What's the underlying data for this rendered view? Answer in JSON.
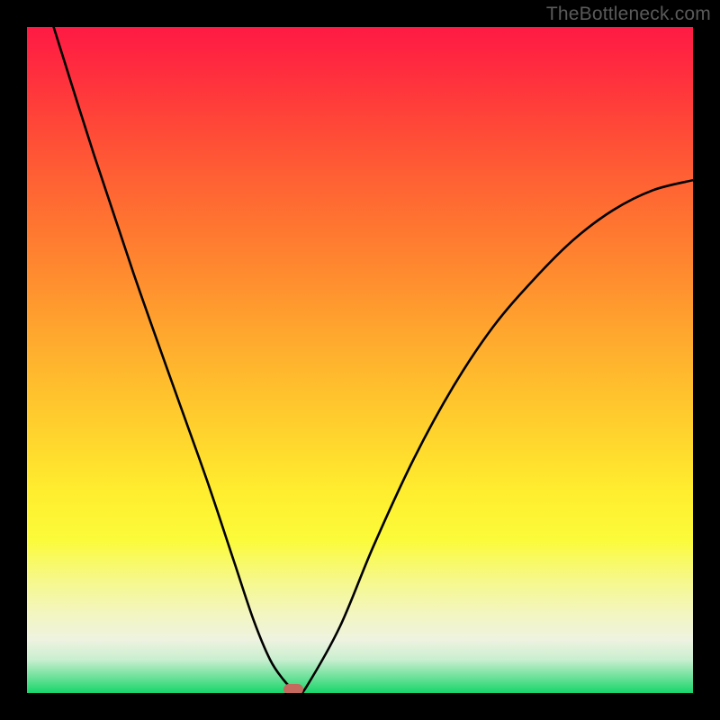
{
  "watermark": "TheBottleneck.com",
  "chart_data": {
    "type": "line",
    "title": "",
    "xlabel": "",
    "ylabel": "",
    "xlim": [
      0,
      100
    ],
    "ylim": [
      0,
      100
    ],
    "grid": false,
    "legend": false,
    "background": "vertical-gradient-red-to-green",
    "series": [
      {
        "name": "bottleneck-curve",
        "x": [
          4,
          10,
          16,
          22,
          27,
          31,
          34,
          36.5,
          38.5,
          40,
          41,
          42,
          47,
          52,
          58,
          64,
          70,
          76,
          82,
          88,
          94,
          100
        ],
        "y": [
          100,
          81,
          63,
          46,
          32,
          20,
          11,
          5,
          2,
          0.5,
          0.2,
          1,
          10,
          22,
          35,
          46,
          55,
          62,
          68,
          72.5,
          75.5,
          77
        ]
      }
    ],
    "marker": {
      "x": 40,
      "y": 0.5,
      "color": "#c5695f"
    },
    "colors": {
      "top": "#ff1a44",
      "mid": "#ffd62d",
      "bottom": "#18d56a",
      "curve": "#000000",
      "frame": "#000000"
    }
  }
}
